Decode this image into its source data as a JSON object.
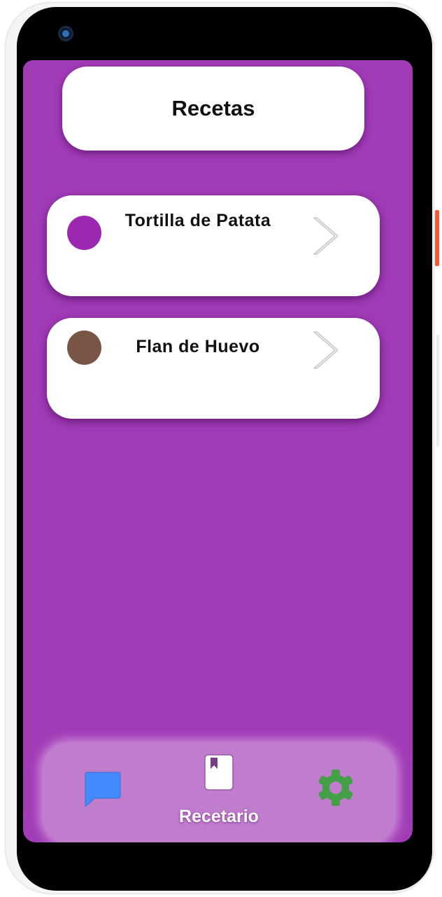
{
  "header": {
    "title": "Recetas"
  },
  "recipes": [
    {
      "name": "Tortilla de Patata",
      "dot_color": "#9c27b0"
    },
    {
      "name": "Flan de Huevo",
      "dot_color": "#795548"
    }
  ],
  "bottom_nav": {
    "items": [
      {
        "icon": "chat-bubble-icon",
        "color": "#448aff",
        "label": ""
      },
      {
        "icon": "book-icon",
        "color": "#ffffff",
        "label": "Recetario"
      },
      {
        "icon": "gear-icon",
        "color": "#43a047",
        "label": ""
      }
    ]
  },
  "colors": {
    "screen_background": "#a13bb6",
    "nav_background": "#c07ccd"
  }
}
